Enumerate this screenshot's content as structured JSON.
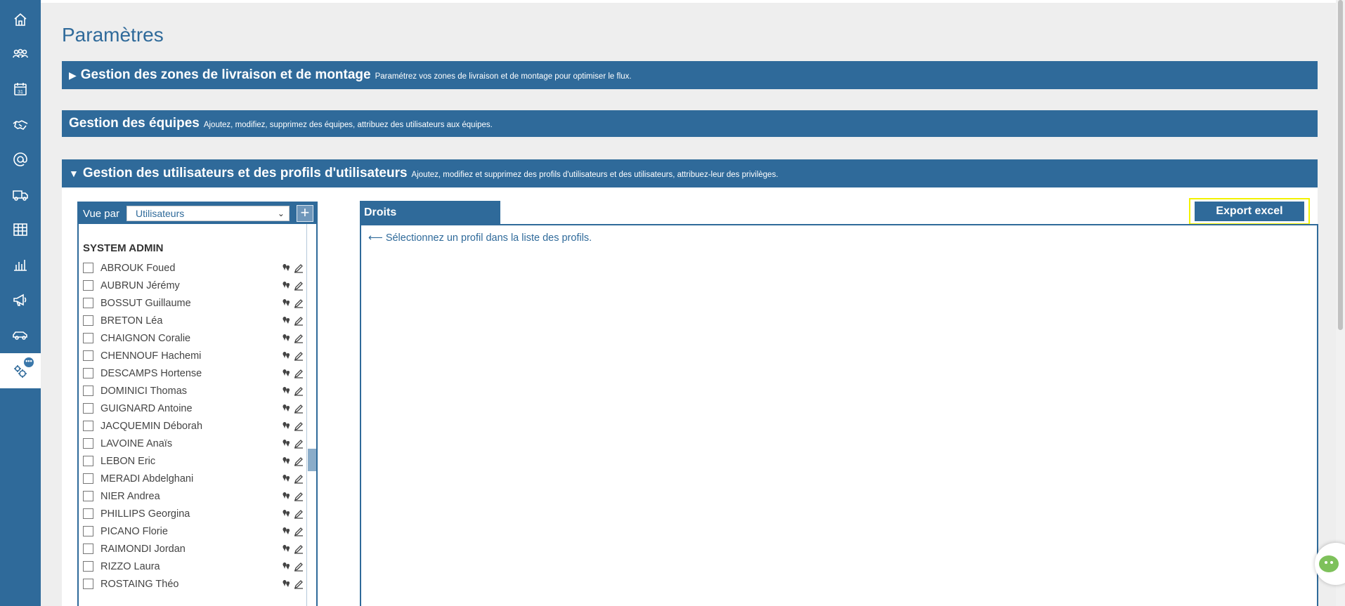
{
  "sidebar": {
    "items": [
      {
        "name": "home-icon"
      },
      {
        "name": "team-icon"
      },
      {
        "name": "calendar-icon",
        "badge_text": "31"
      },
      {
        "name": "handshake-icon"
      },
      {
        "name": "at-icon"
      },
      {
        "name": "truck-icon"
      },
      {
        "name": "table-icon"
      },
      {
        "name": "bar-chart-icon"
      },
      {
        "name": "megaphone-icon"
      },
      {
        "name": "car-icon"
      },
      {
        "name": "gears-icon",
        "active": true,
        "badge": "•••"
      }
    ]
  },
  "page": {
    "title": "Paramètres"
  },
  "sections": {
    "zones": {
      "toggle": "▶",
      "title": "Gestion des zones de livraison et de montage",
      "description": "Paramétrez vos zones de livraison et de montage pour optimiser le flux."
    },
    "equipes": {
      "title": "Gestion des équipes",
      "description": "Ajoutez, modifiez, supprimez des équipes, attribuez des utilisateurs aux équipes."
    },
    "users": {
      "toggle": "▼",
      "title": "Gestion des utilisateurs et des profils d'utilisateurs",
      "description": "Ajoutez, modifiez et supprimez des profils d'utilisateurs et des utilisateurs, attribuez-leur des privilèges."
    }
  },
  "left_panel": {
    "vue_par_label": "Vue par",
    "vue_par_value": "Utilisateurs",
    "add_button": "+",
    "group_title": "SYSTEM ADMIN",
    "users": [
      "ABROUK Foued",
      "AUBRUN Jérémy",
      "BOSSUT Guillaume",
      "BRETON Léa",
      "CHAIGNON Coralie",
      "CHENNOUF Hachemi",
      "DESCAMPS Hortense",
      "DOMINICI Thomas",
      "GUIGNARD Antoine",
      "JACQUEMIN Déborah",
      "LAVOINE Anaïs",
      "LEBON Eric",
      "MERADI Abdelghani",
      "NIER Andrea",
      "PHILLIPS Georgina",
      "PICANO Florie",
      "RAIMONDI Jordan",
      "RIZZO Laura",
      "ROSTAING Théo"
    ]
  },
  "right_panel": {
    "tab_label": "Droits",
    "hint": "⟵ Sélectionnez un profil dans la liste des profils.",
    "export_button": "Export excel"
  },
  "colors": {
    "primary": "#2f6a9a",
    "highlight": "#f2f200",
    "chat": "#7ec15b"
  }
}
